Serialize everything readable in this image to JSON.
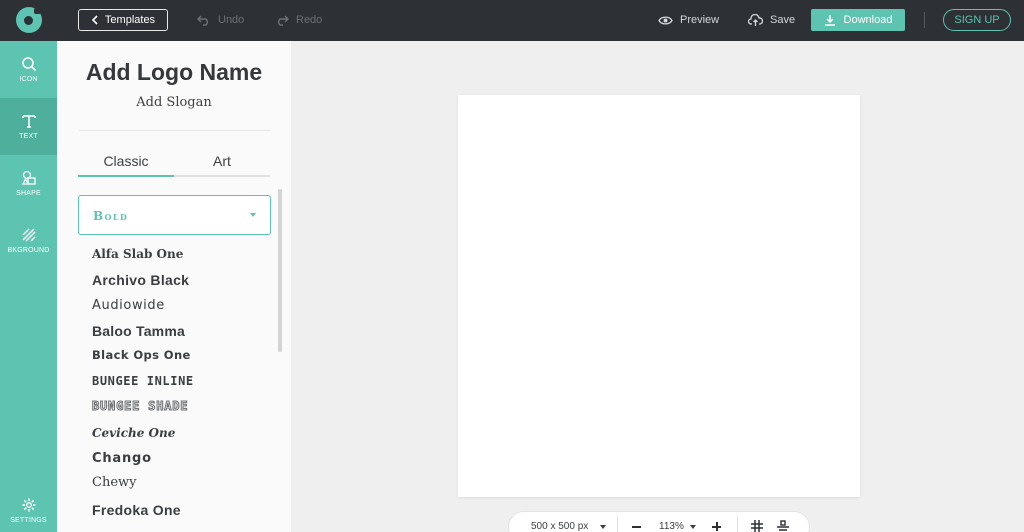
{
  "topbar": {
    "templates_label": "Templates",
    "undo_label": "Undo",
    "redo_label": "Redo",
    "preview_label": "Preview",
    "save_label": "Save",
    "download_label": "Download",
    "signup_label": "SIGN UP"
  },
  "rail": {
    "items": [
      {
        "label": "ICON",
        "icon": "search-icon"
      },
      {
        "label": "TEXT",
        "icon": "text-icon"
      },
      {
        "label": "SHAPE",
        "icon": "shape-icon"
      },
      {
        "label": "BKGROUND",
        "icon": "background-icon"
      }
    ],
    "settings_label": "SETTINGS"
  },
  "panel": {
    "logo_name": "Add Logo Name",
    "slogan": "Add Slogan",
    "tabs": [
      {
        "label": "Classic"
      },
      {
        "label": "Art"
      }
    ],
    "category": "Bold",
    "fonts": [
      "Alfa Slab One",
      "Archivo Black",
      "Audiowide",
      "Baloo Tamma",
      "Black Ops One",
      "BUNGEE INLINE",
      "BUNGEE SHADE",
      "Ceviche One",
      "Chango",
      "Chewy",
      "Fredoka One"
    ]
  },
  "bottom_bar": {
    "size": "500 x 500 px",
    "zoom": "113%"
  },
  "colors": {
    "accent": "#5cc4b0",
    "topbar": "#2d3035",
    "canvas_bg": "#efefef"
  }
}
